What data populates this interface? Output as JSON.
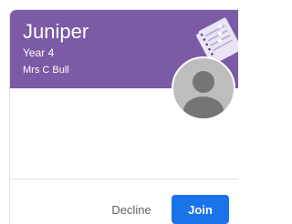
{
  "class_card": {
    "name": "Juniper",
    "section": "Year 4",
    "teacher": "Mrs C Bull",
    "header_color": "#7b5aa6",
    "illustration_icon": "notebook-illustration-icon",
    "more_icon": "more-vert-icon",
    "avatar_icon": "person-avatar-icon",
    "actions": {
      "decline_label": "Decline",
      "join_label": "Join"
    },
    "accent_color": "#1a73e8"
  }
}
